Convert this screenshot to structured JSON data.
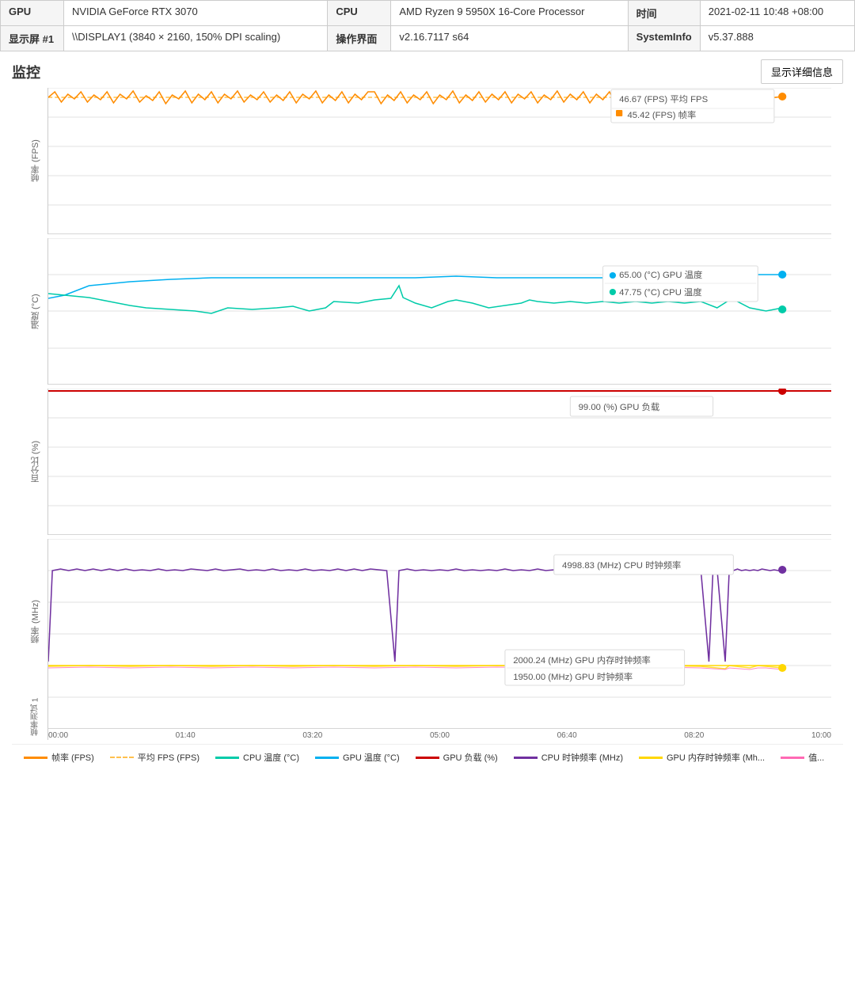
{
  "header": {
    "gpu_label": "GPU",
    "gpu_value": "NVIDIA GeForce RTX 3070",
    "display_label": "显示屏 #1",
    "display_value": "\\\\DISPLAY1 (3840 × 2160, 150% DPI scaling)",
    "cpu_label": "CPU",
    "cpu_value": "AMD Ryzen 9 5950X 16-Core Processor",
    "os_label": "操作界面",
    "os_value": "v2.16.7117 s64",
    "time_label": "时间",
    "time_value": "2021-02-11 10:48 +08:00",
    "sysinfo_label": "SystemInfo",
    "sysinfo_value": "v5.37.888"
  },
  "monitor": {
    "title": "监控",
    "detail_btn": "显示详细信息"
  },
  "charts": {
    "fps_chart": {
      "y_label": "帧率 (FPS)",
      "tooltip1": "46.67 (FPS) 平均 FPS",
      "tooltip2": "45.42 (FPS) 帧率"
    },
    "temp_chart": {
      "y_label": "温度 (°C)",
      "tooltip1": "65.00 (°C) GPU 温度",
      "tooltip2": "47.75 (°C) CPU 温度"
    },
    "load_chart": {
      "y_label": "百分比 (%)",
      "tooltip1": "99.00 (%) GPU 负载"
    },
    "freq_chart": {
      "y_label": "频率 (MHz)",
      "y_label2": "帧率测试 1",
      "tooltip1": "4998.83 (MHz) CPU 时钟频率",
      "tooltip2": "2000.24 (MHz) GPU 内存时钟频率",
      "tooltip3": "1950.00 (MHz) GPU 时钟频率"
    }
  },
  "x_axis": {
    "labels": [
      "00:00",
      "01:40",
      "03:20",
      "05:00",
      "06:40",
      "08:20",
      "10:00"
    ]
  },
  "legend": {
    "items": [
      {
        "label": "帧率 (FPS)",
        "color": "#FF8C00",
        "type": "solid"
      },
      {
        "label": "平均 FPS (FPS)",
        "color": "#FFC04D",
        "type": "dashed"
      },
      {
        "label": "CPU 温度 (°C)",
        "color": "#00CBA9",
        "type": "solid"
      },
      {
        "label": "GPU 温度 (°C)",
        "color": "#00B0F0",
        "type": "solid"
      },
      {
        "label": "GPU 负载 (%)",
        "color": "#CC0000",
        "type": "solid"
      },
      {
        "label": "CPU 时钟频率 (MHz)",
        "color": "#7030A0",
        "type": "solid"
      },
      {
        "label": "GPU 内存时钟频率 (Mh...",
        "color": "#FFD700",
        "type": "solid"
      },
      {
        "label": "值...",
        "color": "#FF69B4",
        "type": "solid"
      }
    ]
  }
}
